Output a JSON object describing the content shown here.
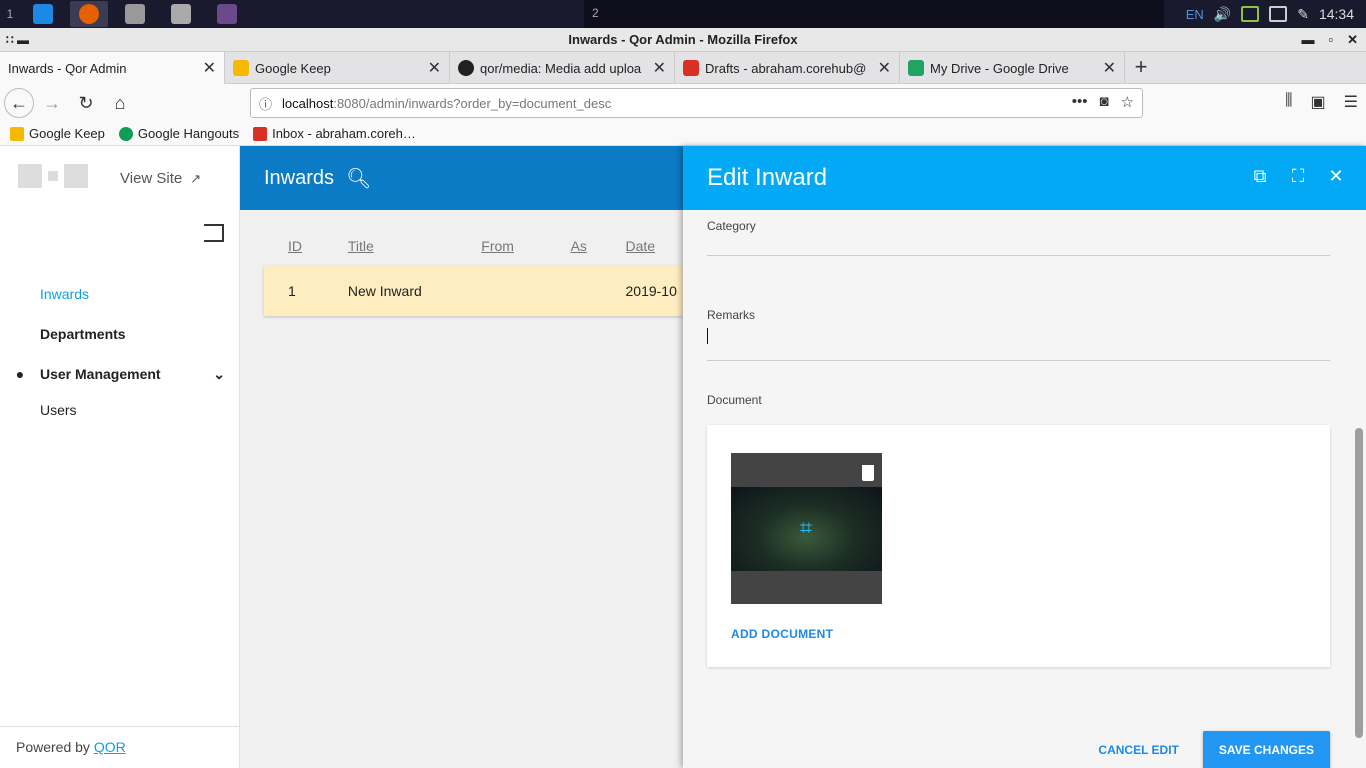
{
  "taskbar": {
    "workspace_1": "1",
    "workspace_2": "2",
    "lang": "EN",
    "clock": "14:34"
  },
  "window": {
    "title": "Inwards - Qor Admin - Mozilla Firefox"
  },
  "tabs": [
    {
      "label": "Inwards - Qor Admin",
      "favicon_color": "#ffffff"
    },
    {
      "label": "Google Keep",
      "favicon_color": "#f6b900"
    },
    {
      "label": "qor/media: Media add uploa",
      "favicon_color": "#222222"
    },
    {
      "label": "Drafts - abraham.corehub@",
      "favicon_color": "#d93025"
    },
    {
      "label": "My Drive - Google Drive",
      "favicon_color": "#1fa463"
    }
  ],
  "url": {
    "host": "localhost",
    "rest": ":8080/admin/inwards?order_by=document_desc"
  },
  "bookmarks": [
    {
      "label": "Google Keep",
      "color": "#f6b900"
    },
    {
      "label": "Google Hangouts",
      "color": "#0f9d58"
    },
    {
      "label": "Inbox - abraham.coreh…",
      "color": "#d93025"
    }
  ],
  "sidebar": {
    "view_site": "View Site",
    "items": [
      {
        "label": "Inwards"
      },
      {
        "label": "Departments"
      }
    ],
    "group": {
      "label": "User Management",
      "sub": "Users"
    },
    "powered_prefix": "Powered by ",
    "powered_link": "QOR"
  },
  "main": {
    "title": "Inwards",
    "columns": [
      "ID",
      "Title",
      "From",
      "As",
      "Date"
    ],
    "rows": [
      {
        "id": "1",
        "title": "New Inward",
        "from": "",
        "as": "",
        "date": "2019-10"
      }
    ]
  },
  "panel": {
    "title": "Edit Inward",
    "category_label": "Category",
    "remarks_label": "Remarks",
    "document_label": "Document",
    "add_document": "ADD DOCUMENT",
    "cancel": "CANCEL EDIT",
    "save": "SAVE CHANGES"
  },
  "colors": {
    "accent": "#03a9f4",
    "header_dark": "#0a7bc4",
    "row_highlight": "#ffedc2"
  }
}
